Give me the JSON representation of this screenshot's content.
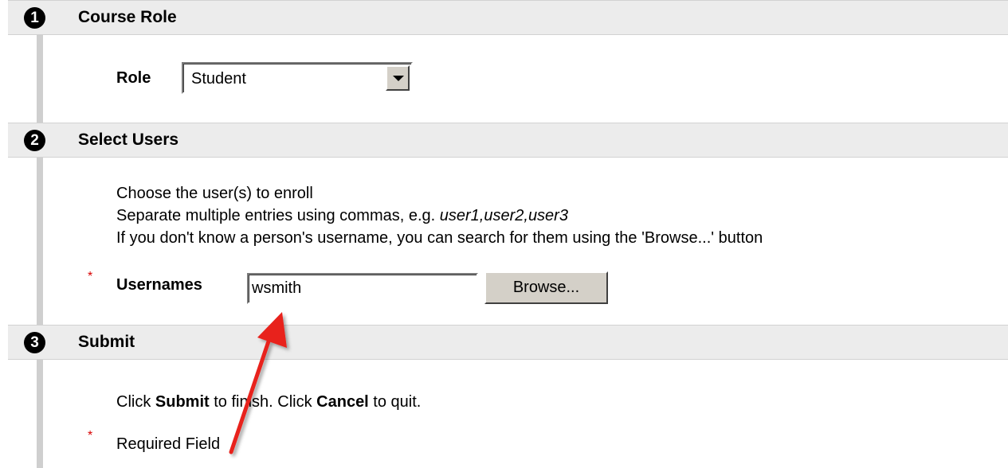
{
  "sections": [
    {
      "number": "1",
      "title": "Course Role"
    },
    {
      "number": "2",
      "title": "Select Users"
    },
    {
      "number": "3",
      "title": "Submit"
    }
  ],
  "course_role": {
    "role_label": "Role",
    "role_selected": "Student"
  },
  "select_users": {
    "instruction_1": "Choose the user(s) to enroll",
    "instruction_2_prefix": "Separate multiple entries using commas, e.g. ",
    "instruction_2_example": "user1,user2,user3",
    "instruction_3": "If you don't know a person's username, you can search for them using the 'Browse...' button",
    "required_marker": "*",
    "usernames_label": "Usernames",
    "usernames_value": "wsmith",
    "browse_label": "Browse..."
  },
  "submit": {
    "text_click_1": "Click ",
    "submit_word": "Submit",
    "text_mid": " to finish. Click ",
    "cancel_word": "Cancel",
    "text_end": " to quit.",
    "required_marker": "*",
    "required_field_label": "Required Field"
  },
  "colors": {
    "header_bg": "#ececec",
    "required_star": "#d80000",
    "annotation_arrow": "#e8201c"
  }
}
